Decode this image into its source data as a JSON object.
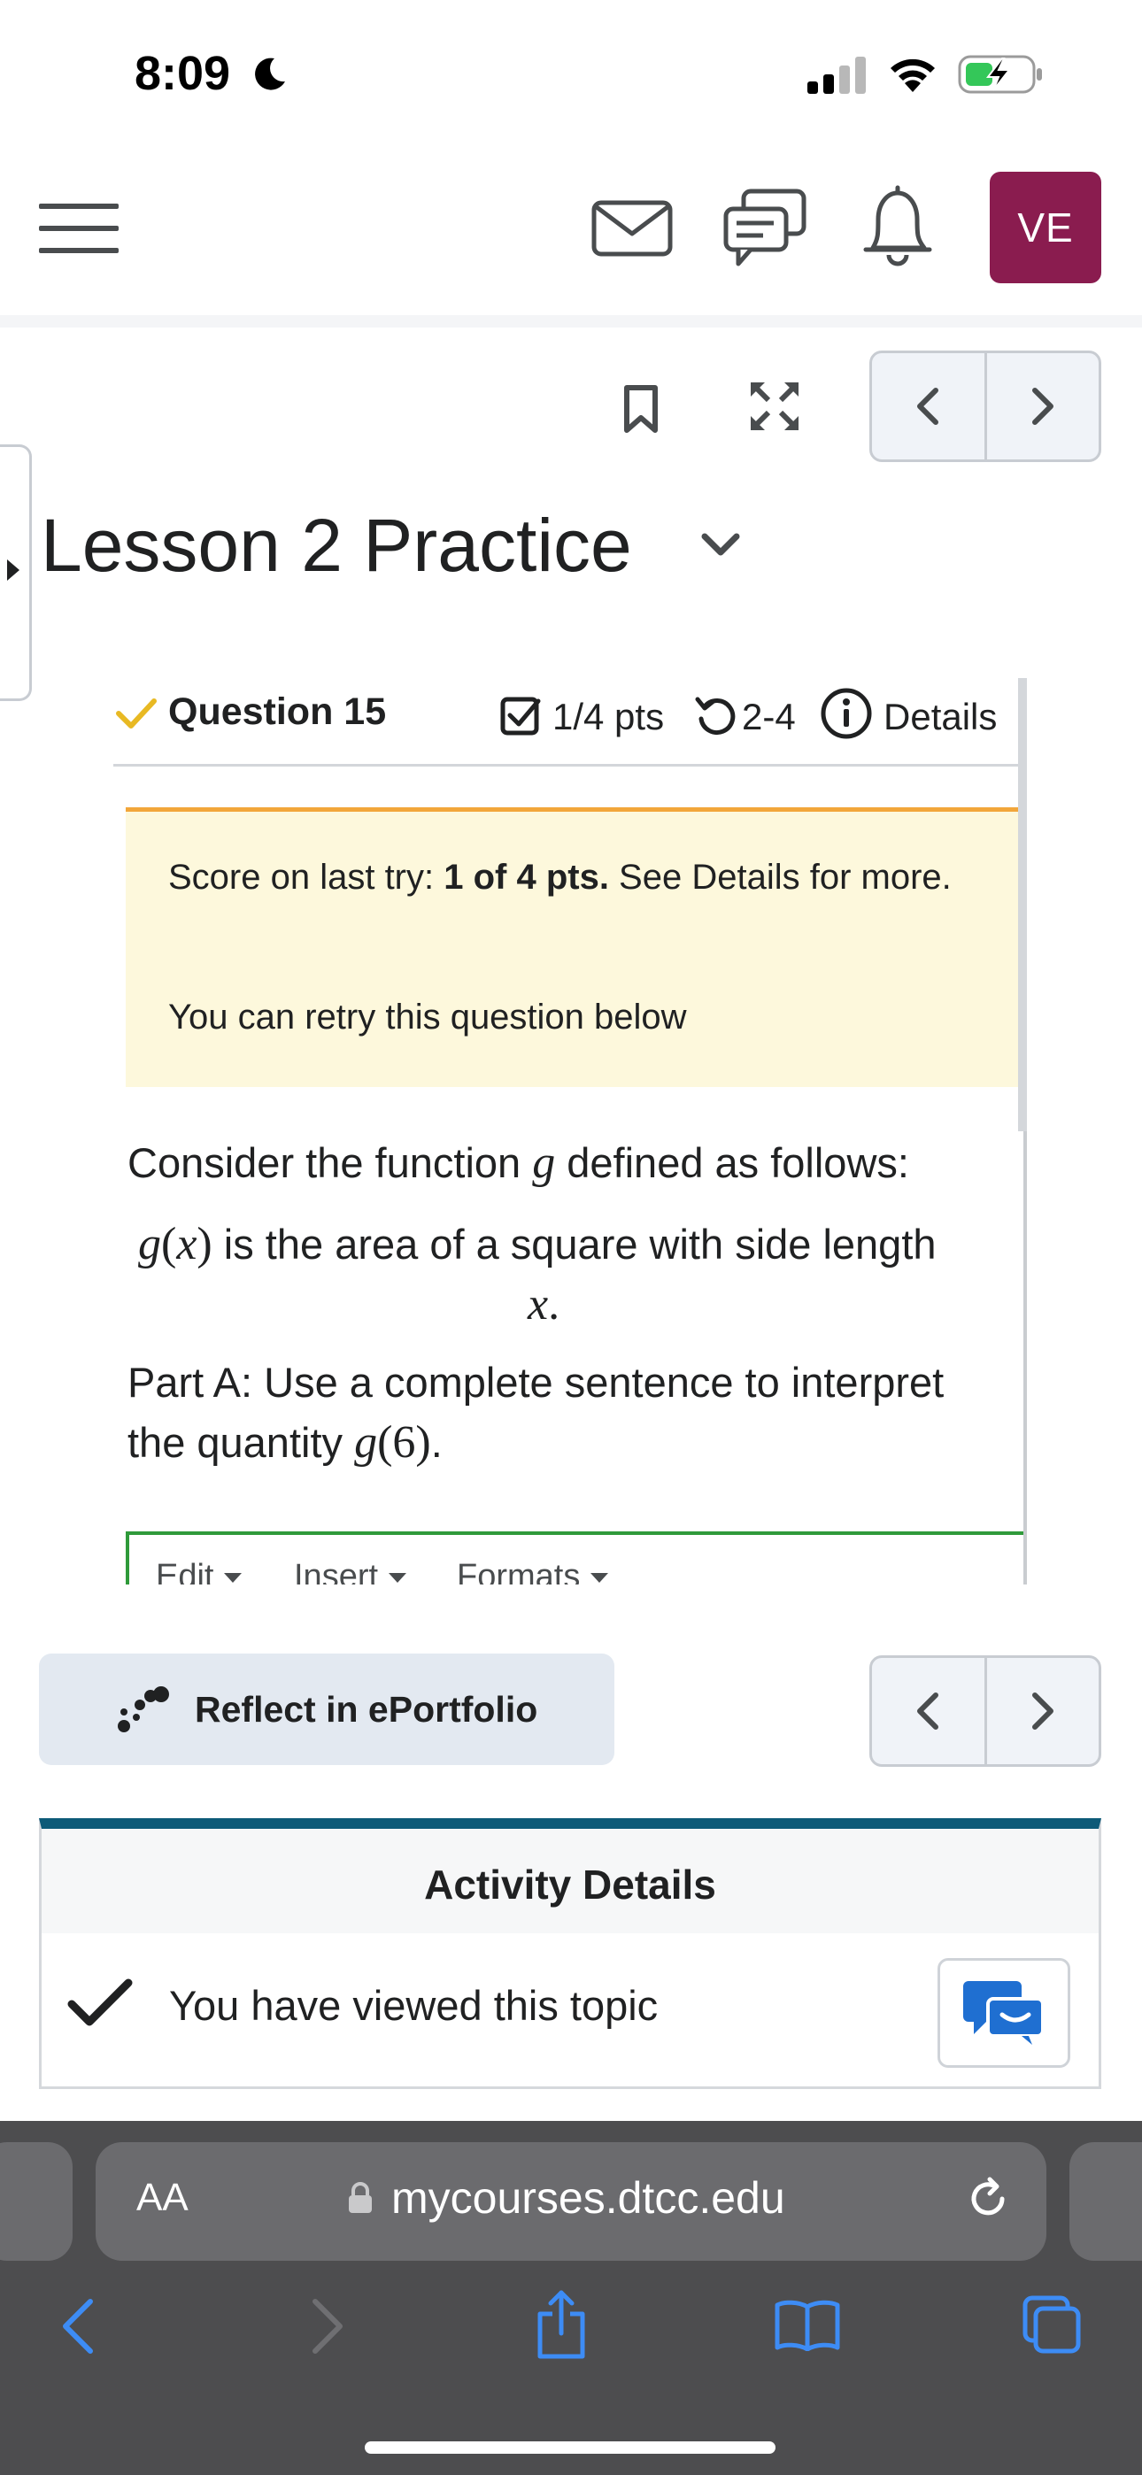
{
  "status_bar": {
    "time": "8:09"
  },
  "header": {
    "avatar_initials": "VE"
  },
  "page": {
    "title": "Lesson 2 Practice"
  },
  "question": {
    "label": "Question 15",
    "points": "1/4 pts",
    "attempts": "2-4",
    "details_label": "Details",
    "alert": {
      "score_prefix": "Score on last try: ",
      "score_value": "1 of 4 pts.",
      "score_suffix": " See Details for more.",
      "retry_text": "You can retry this question below"
    },
    "body": {
      "line1_a": "Consider the function ",
      "line1_var": "g",
      "line1_b": " defined as follows:",
      "line2_func": "g",
      "line2_paren_open": "(",
      "line2_var": "x",
      "line2_paren_close": ")",
      "line2_text": " is the area of a square with side length",
      "line3_var": "x",
      "line3_dot": ".",
      "part_a_line1": "Part A: Use a complete sentence to interpret",
      "part_a_line2_a": "the quantity ",
      "part_a_func": "g",
      "part_a_arg": "(6)",
      "part_a_end": "."
    },
    "editor_menu": [
      "Edit",
      "Insert",
      "Formats"
    ]
  },
  "reflect_button": {
    "label": "Reflect in ePortfolio"
  },
  "activity": {
    "title": "Activity Details",
    "viewed_text": "You have viewed this topic"
  },
  "browser": {
    "aa_label": "AA",
    "url": "mycourses.dtcc.edu"
  },
  "colors": {
    "avatar_bg": "#8a1c4f",
    "alert_bg": "#fdf8dc",
    "alert_border": "#f2a63a",
    "editor_border": "#2f9a3a",
    "activity_accent": "#0d5a78",
    "ios_blue": "#3d8cf5"
  },
  "icons": [
    "moon-icon",
    "signal-icon",
    "wifi-icon",
    "battery-charging-icon",
    "hamburger-icon",
    "mail-icon",
    "chat-icon",
    "bell-icon",
    "bookmark-icon",
    "expand-icon",
    "chevron-left-icon",
    "chevron-right-icon",
    "chevron-down-icon",
    "check-icon",
    "checkbox-icon",
    "retry-icon",
    "info-icon",
    "eportfolio-icon",
    "checkmark-icon",
    "feedback-icon",
    "lock-icon",
    "reload-icon",
    "share-icon",
    "bookmarks-icon",
    "tabs-icon"
  ]
}
